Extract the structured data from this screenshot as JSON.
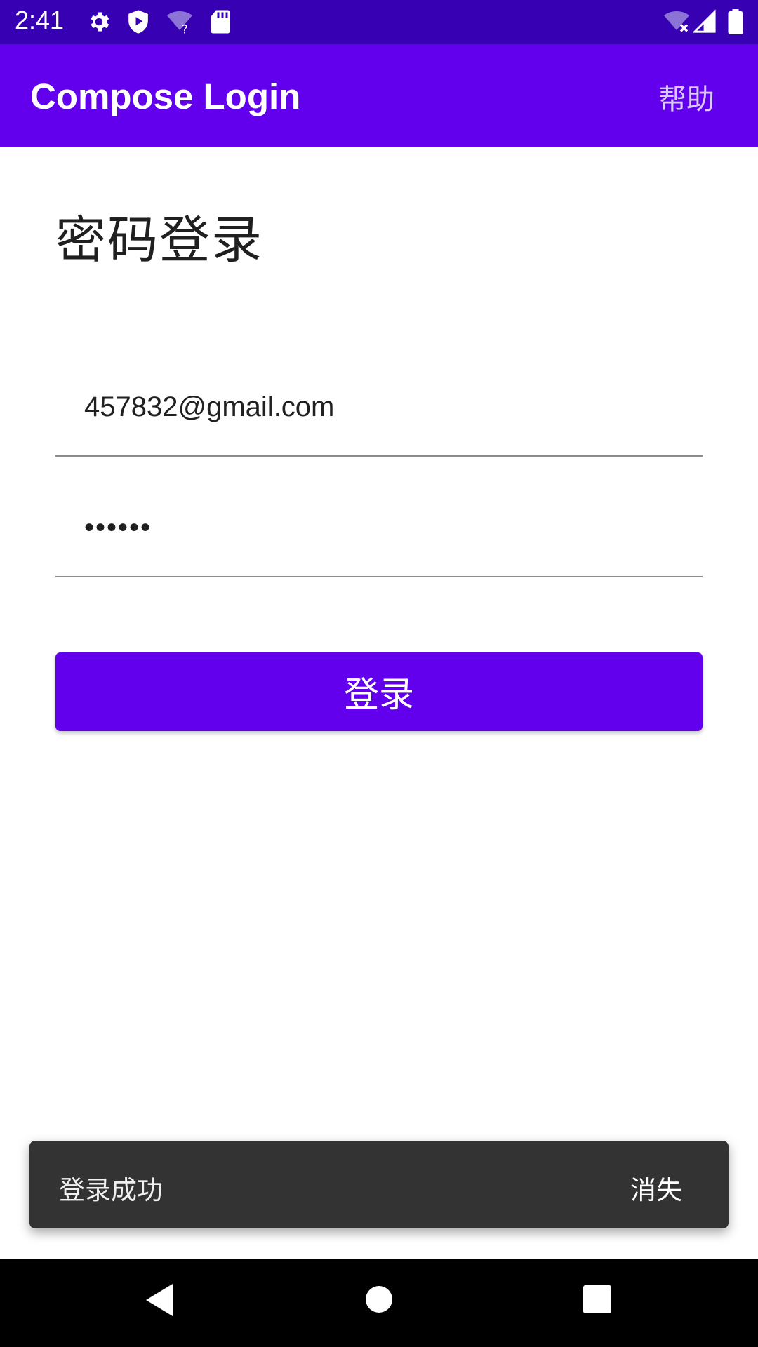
{
  "status_bar": {
    "time": "2:41",
    "icons": [
      "gear-icon",
      "shield-play-icon",
      "wifi-question-icon",
      "sd-card-icon",
      "wifi-off-icon",
      "cell-signal-icon",
      "battery-icon"
    ]
  },
  "app_bar": {
    "title": "Compose Login",
    "help_label": "帮助"
  },
  "page": {
    "title": "密码登录",
    "email_value": "457832@gmail.com",
    "password_value": "••••••",
    "login_label": "登录"
  },
  "snackbar": {
    "message": "登录成功",
    "action_label": "消失"
  },
  "nav_bar": {
    "icons": [
      "back-icon",
      "home-icon",
      "recents-icon"
    ]
  },
  "colors": {
    "status_bar": "#3700b3",
    "primary": "#6200ee",
    "snackbar": "#333333"
  }
}
